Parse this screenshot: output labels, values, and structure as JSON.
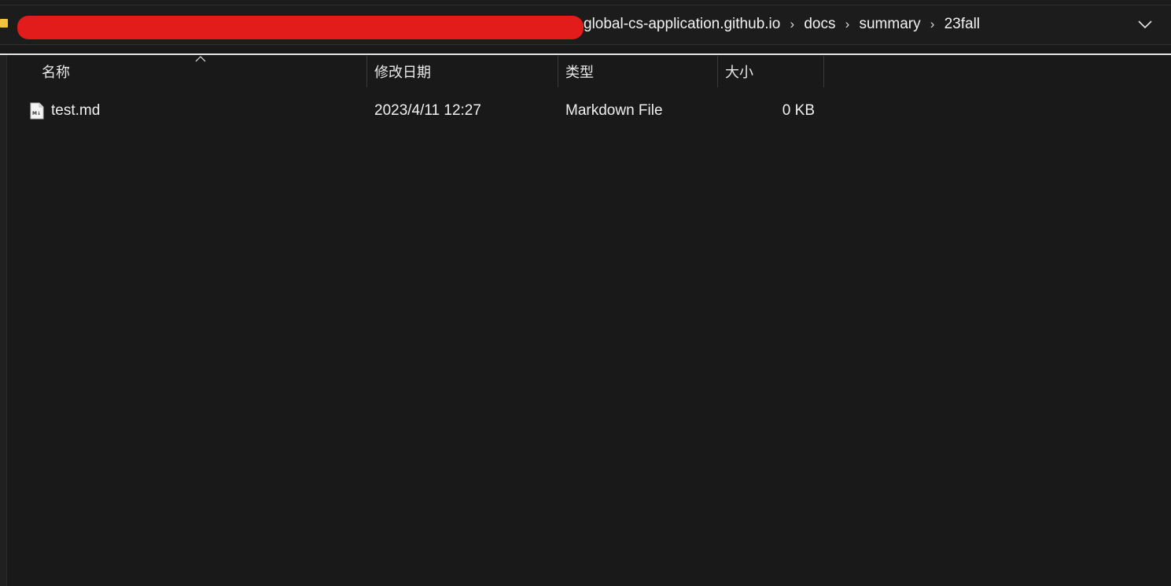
{
  "address_bar": {
    "breadcrumbs": [
      {
        "label": "global-cs-application.github.io"
      },
      {
        "label": "docs"
      },
      {
        "label": "summary"
      },
      {
        "label": "23fall"
      }
    ],
    "separator": "›"
  },
  "columns": {
    "name": "名称",
    "modified": "修改日期",
    "type": "类型",
    "size": "大小"
  },
  "files": [
    {
      "name": "test.md",
      "modified": "2023/4/11 12:27",
      "type": "Markdown File",
      "size": "0 KB",
      "icon": "markdown-file-icon"
    }
  ],
  "colors": {
    "background": "#191919",
    "redaction": "#e21b1b",
    "folder": "#f1c23e",
    "text": "#f0f0f0"
  }
}
